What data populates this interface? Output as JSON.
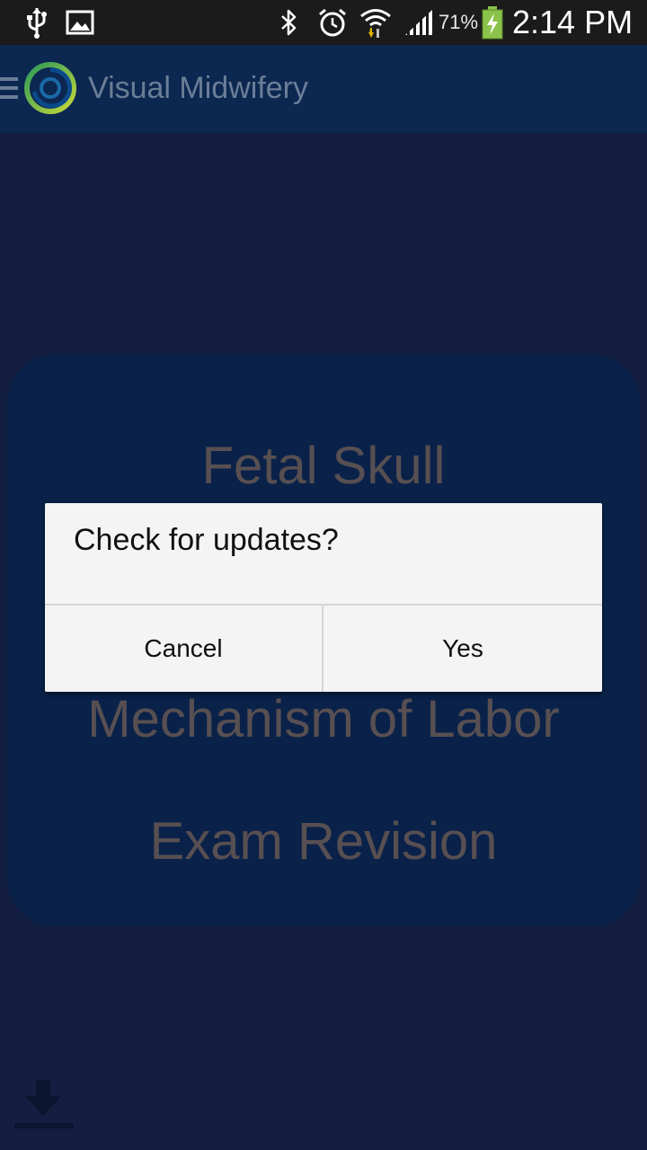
{
  "status_bar": {
    "battery_percent": "71%",
    "time": "2:14 PM",
    "icons": [
      "usb-icon",
      "image-notification-icon",
      "bluetooth-icon",
      "alarm-icon",
      "wifi-icon",
      "signal-icon",
      "battery-charging-icon"
    ]
  },
  "action_bar": {
    "title": "Visual Midwifery",
    "icons": [
      "hamburger-icon",
      "app-logo-icon"
    ]
  },
  "menu": {
    "items": [
      {
        "label": "Fetal Skull"
      },
      {
        "label": "Mechanism of Labor"
      },
      {
        "label": "Exam Revision"
      }
    ]
  },
  "dialog": {
    "message": "Check for updates?",
    "cancel_label": "Cancel",
    "confirm_label": "Yes"
  },
  "bottom": {
    "icon": "download-icon"
  },
  "colors": {
    "background": "#131e40",
    "action_bar": "#0c2750",
    "menu_card": "#0a2249",
    "menu_text": "#584f52",
    "dialog_bg": "#f4f4f4",
    "status_bar": "#1b1b1b"
  }
}
